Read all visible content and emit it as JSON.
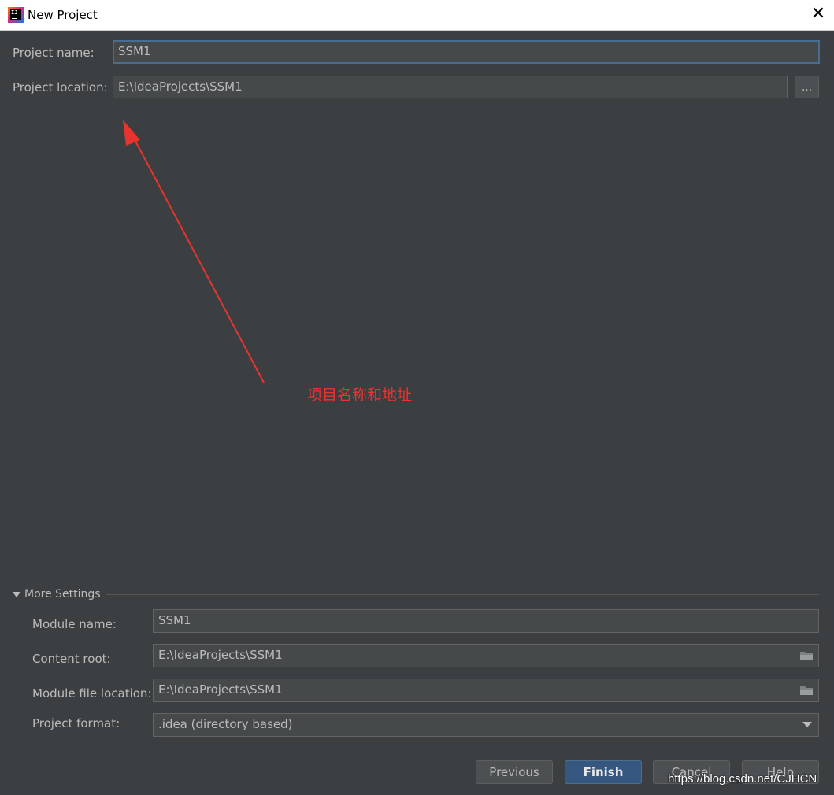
{
  "window": {
    "title": "New Project",
    "close_glyph": "✕"
  },
  "form": {
    "project_name_label": "Project name:",
    "project_name_value": "SSM1",
    "project_location_label": "Project location:",
    "project_location_value": "E:\\IdeaProjects\\SSM1",
    "browse_label": "..."
  },
  "annotation": {
    "text": "项目名称和地址",
    "color": "#e8342f"
  },
  "more_settings": {
    "header": "More Settings",
    "module_name_label": "Module name:",
    "module_name_value": "SSM1",
    "content_root_label": "Content root:",
    "content_root_value": "E:\\IdeaProjects\\SSM1",
    "module_file_location_label": "Module file location:",
    "module_file_location_value": "E:\\IdeaProjects\\SSM1",
    "project_format_label": "Project format:",
    "project_format_value": ".idea (directory based)"
  },
  "buttons": {
    "previous": "Previous",
    "finish": "Finish",
    "cancel": "Cancel",
    "help": "Help"
  },
  "watermark": "https://blog.csdn.net/CJHCN",
  "icons": [
    "intellij-app-icon",
    "close-icon",
    "folder-icon",
    "triangle-down-icon",
    "chevron-down-icon",
    "arrow-annotation"
  ],
  "colors": {
    "background": "#3c3f41",
    "field": "#45494a",
    "focus_border": "#466d94",
    "default_button": "#365880",
    "annotation": "#e8342f"
  }
}
